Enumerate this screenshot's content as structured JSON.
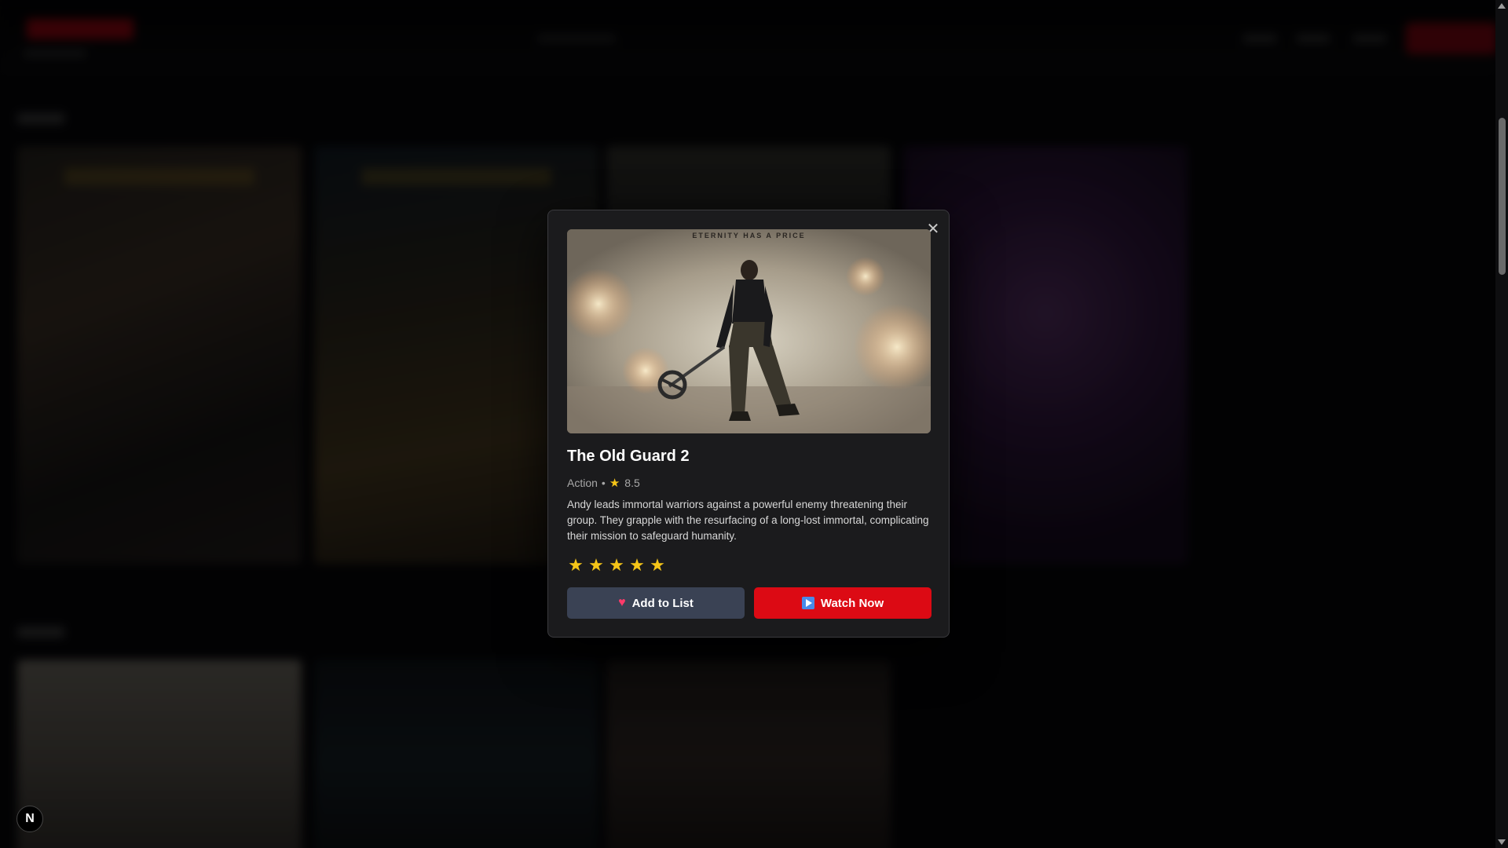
{
  "modal": {
    "close_icon": "close-icon",
    "poster_tagline": "ETERNITY HAS A PRICE",
    "title": "The Old Guard 2",
    "genre": "Action",
    "separator": "•",
    "rating": "8.5",
    "rating_icon": "star-icon",
    "description": "Andy leads immortal warriors against a powerful enemy threatening their group. They grapple with the resurfacing of a long-lost immortal, complicating their mission to safeguard humanity.",
    "user_rating": {
      "stars_filled": 5,
      "stars_total": 5,
      "star_glyph": "★"
    },
    "add_button": {
      "icon": "heart-icon",
      "icon_glyph": "♥",
      "label": "Add to List"
    },
    "watch_button": {
      "icon": "play-icon",
      "label": "Watch Now"
    }
  },
  "badge": {
    "label": "N"
  },
  "colors": {
    "accent_red": "#dc0a14",
    "star_yellow": "#f5c518",
    "modal_bg": "#1b1b1d",
    "add_button_bg": "#3a4254"
  }
}
